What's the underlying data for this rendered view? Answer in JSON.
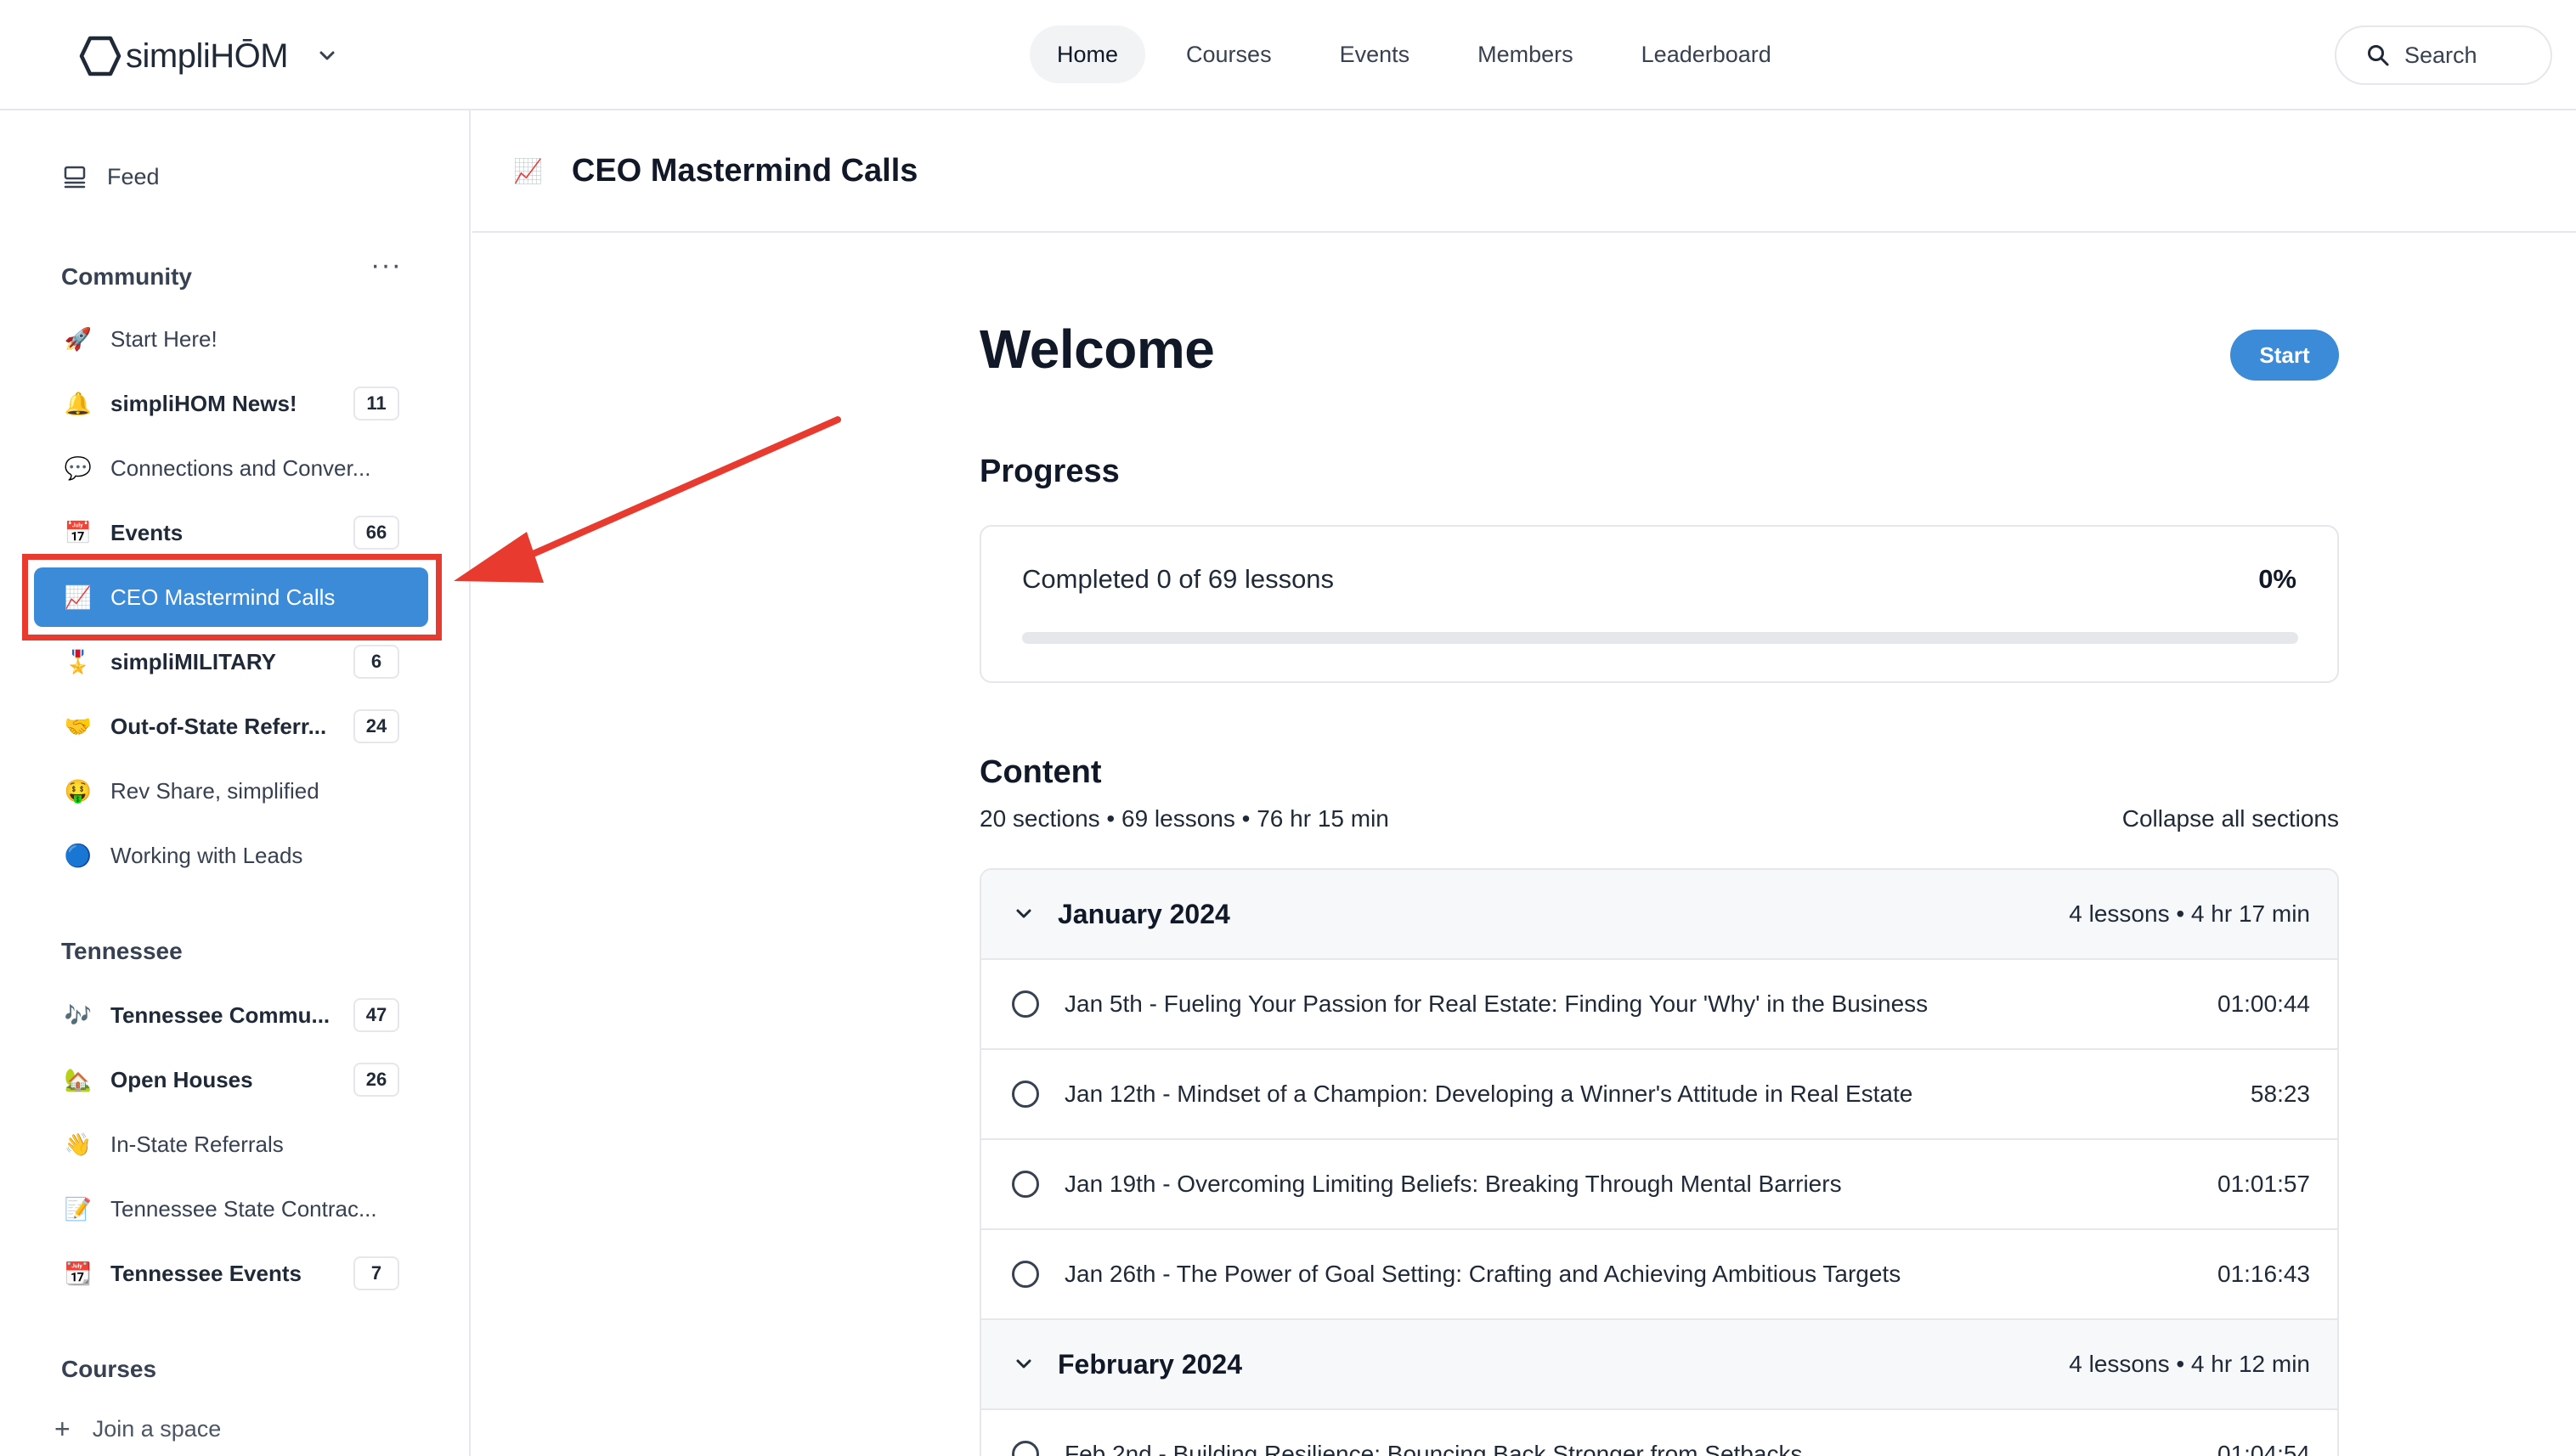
{
  "brand": {
    "logo_text": "simpliHŌM"
  },
  "nav": {
    "items": [
      {
        "label": "Home",
        "active": true
      },
      {
        "label": "Courses",
        "active": false
      },
      {
        "label": "Events",
        "active": false
      },
      {
        "label": "Members",
        "active": false
      },
      {
        "label": "Leaderboard",
        "active": false
      }
    ],
    "search_label": "Search"
  },
  "sidebar": {
    "feed_label": "Feed",
    "community_title": "Community",
    "community_items": [
      {
        "emoji": "🚀",
        "label": "Start Here!",
        "badge": ""
      },
      {
        "emoji": "🔔",
        "label": "simpliHOM News!",
        "badge": "11",
        "bold": true
      },
      {
        "emoji": "💬",
        "label": "Connections and Conver...",
        "badge": ""
      },
      {
        "emoji": "📅",
        "label": "Events",
        "badge": "66",
        "bold": true
      },
      {
        "emoji": "📈",
        "label": "CEO Mastermind Calls",
        "badge": "",
        "active": true
      },
      {
        "emoji": "🎖️",
        "label": "simpliMILITARY",
        "badge": "6",
        "bold": true
      },
      {
        "emoji": "🤝",
        "label": "Out-of-State Referr...",
        "badge": "24",
        "bold": true
      },
      {
        "emoji": "🤑",
        "label": "Rev Share, simplified",
        "badge": ""
      },
      {
        "emoji": "🔵",
        "label": "Working with Leads",
        "badge": ""
      }
    ],
    "tennessee_title": "Tennessee",
    "tennessee_items": [
      {
        "emoji": "🎶",
        "label": "Tennessee Commu...",
        "badge": "47",
        "bold": true
      },
      {
        "emoji": "🏡",
        "label": "Open Houses",
        "badge": "26",
        "bold": true
      },
      {
        "emoji": "👋",
        "label": "In-State Referrals",
        "badge": ""
      },
      {
        "emoji": "📝",
        "label": "Tennessee State Contrac...",
        "badge": ""
      },
      {
        "emoji": "📆",
        "label": "Tennessee Events",
        "badge": "7",
        "bold": true
      }
    ],
    "courses_title": "Courses",
    "join_label": "Join a space"
  },
  "page": {
    "emoji": "📈",
    "title": "CEO Mastermind Calls",
    "welcome": "Welcome",
    "start_label": "Start",
    "progress_title": "Progress",
    "progress_text": "Completed 0 of 69 lessons",
    "progress_pct": "0%",
    "progress_fraction": 0,
    "content_title": "Content",
    "content_meta": "20 sections • 69 lessons • 76 hr 15 min",
    "collapse_label": "Collapse all sections"
  },
  "sections": [
    {
      "title": "January 2024",
      "meta": "4 lessons • 4 hr 17 min",
      "lessons": [
        {
          "title": "Jan 5th - Fueling Your Passion for Real Estate: Finding Your 'Why' in the Business",
          "duration": "01:00:44"
        },
        {
          "title": "Jan 12th - Mindset of a Champion: Developing a Winner's Attitude in Real Estate",
          "duration": "58:23"
        },
        {
          "title": "Jan 19th - Overcoming Limiting Beliefs: Breaking Through Mental Barriers",
          "duration": "01:01:57"
        },
        {
          "title": "Jan 26th - The Power of Goal Setting: Crafting and Achieving Ambitious Targets",
          "duration": "01:16:43"
        }
      ]
    },
    {
      "title": "February 2024",
      "meta": "4 lessons • 4 hr 12 min",
      "lessons": [
        {
          "title": "Feb 2nd - Building Resilience: Bouncing Back Stronger from Setbacks",
          "duration": "01:04:54"
        }
      ]
    }
  ],
  "colors": {
    "accent": "#3b8bd8",
    "highlight": "#e83a2e"
  }
}
